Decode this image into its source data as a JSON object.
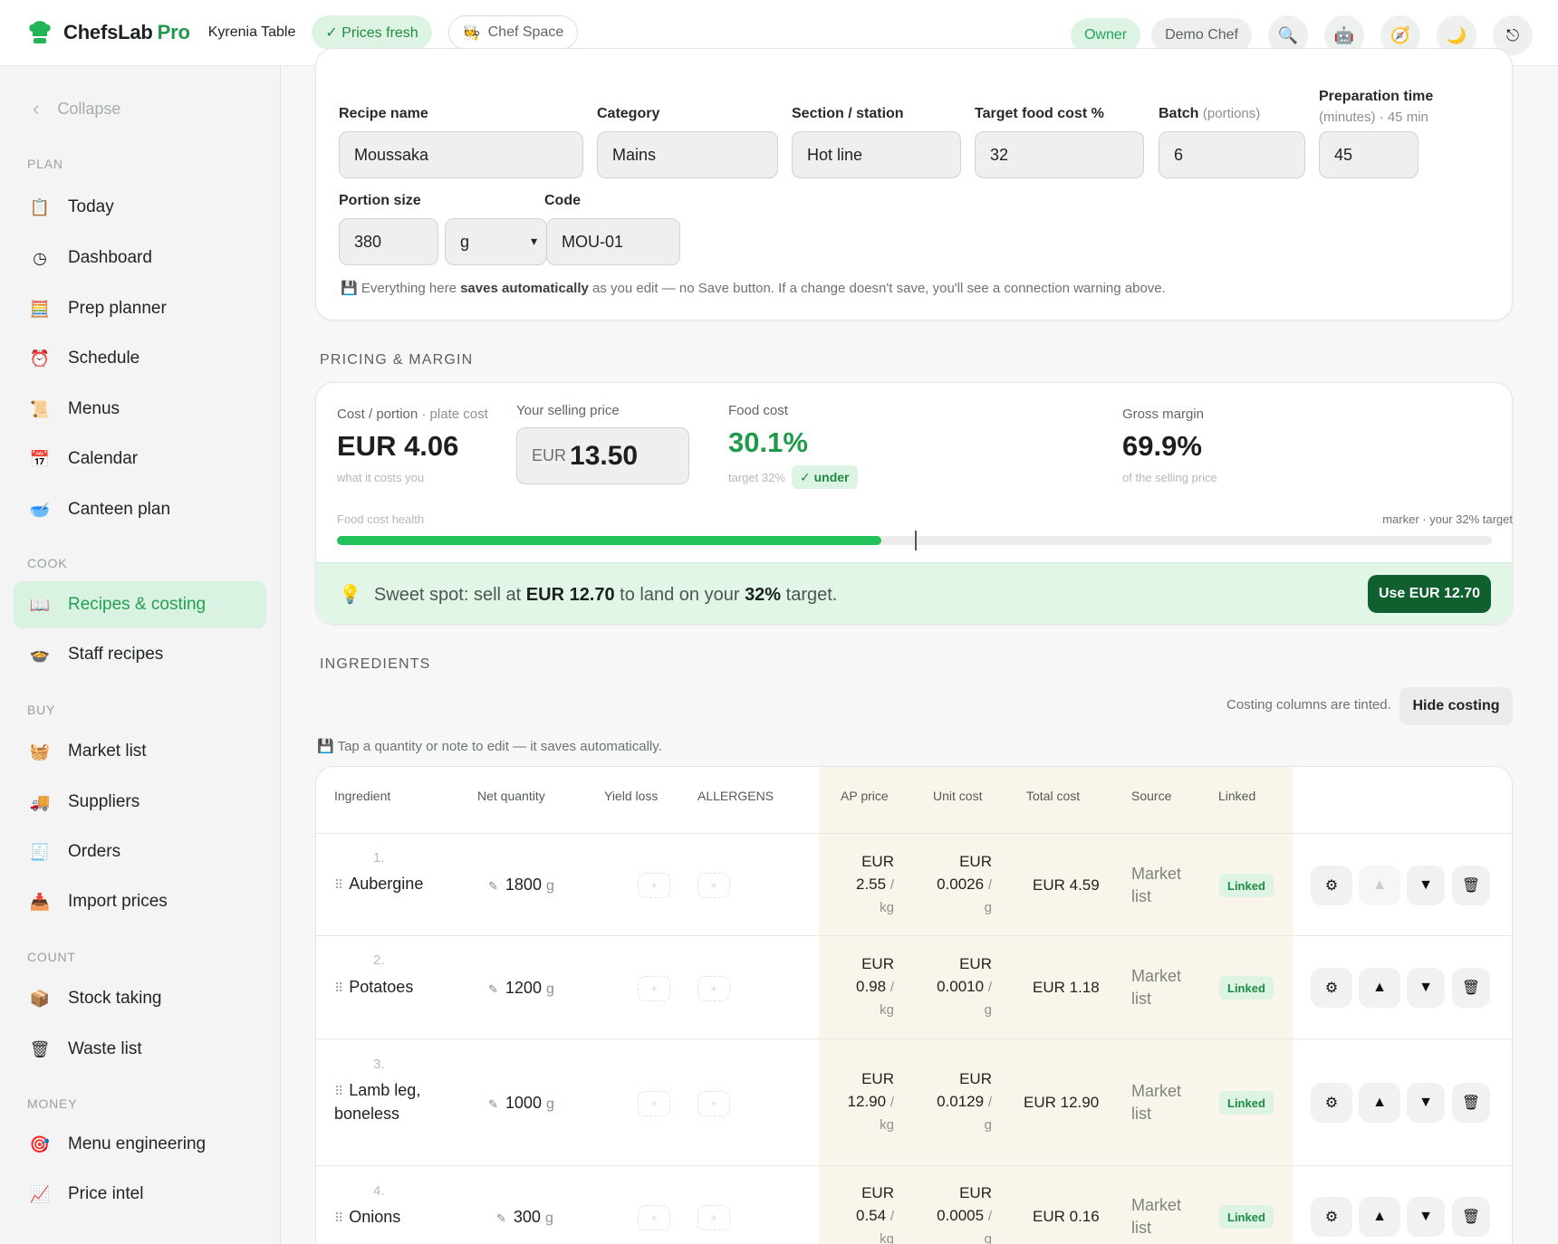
{
  "app": {
    "brand": "ChefsLab",
    "brand_suffix": "Pro",
    "venue": "Kyrenia Table",
    "prices_status": "✓ Prices fresh",
    "chef_space": "Chef Space",
    "role": "Owner",
    "user": "Demo Chef"
  },
  "sidebar": {
    "collapse_label": "Collapse",
    "sections": {
      "plan": "PLAN",
      "cook": "COOK",
      "buy": "BUY",
      "count": "COUNT",
      "money": "MONEY"
    },
    "items": [
      {
        "label": "Today",
        "icon": "clipboard-icon"
      },
      {
        "label": "Dashboard",
        "icon": "clock-icon"
      },
      {
        "label": "Prep planner",
        "icon": "abacus-icon"
      },
      {
        "label": "Schedule",
        "icon": "alarm-clock-icon"
      },
      {
        "label": "Menus",
        "icon": "scroll-icon"
      },
      {
        "label": "Calendar",
        "icon": "calendar-icon"
      },
      {
        "label": "Canteen plan",
        "icon": "bowl-icon"
      },
      {
        "label": "Recipes & costing",
        "icon": "open-book-icon"
      },
      {
        "label": "Staff recipes",
        "icon": "pot-icon"
      },
      {
        "label": "Market list",
        "icon": "basket-icon"
      },
      {
        "label": "Suppliers",
        "icon": "truck-icon"
      },
      {
        "label": "Orders",
        "icon": "receipt-icon"
      },
      {
        "label": "Import prices",
        "icon": "import-icon"
      },
      {
        "label": "Stock taking",
        "icon": "box-icon"
      },
      {
        "label": "Waste list",
        "icon": "trash-basket-icon"
      },
      {
        "label": "Menu engineering",
        "icon": "target-icon"
      },
      {
        "label": "Price intel",
        "icon": "chart-up-icon"
      }
    ]
  },
  "recipe": {
    "labels": {
      "name": "Recipe name",
      "category": "Category",
      "section": "Section / station",
      "target": "Target food cost %",
      "batch": "Batch",
      "batch_sub": "(portions)",
      "prep": "Preparation time",
      "prep_sub": "(minutes) · 45 min",
      "portion": "Portion size",
      "code": "Code"
    },
    "values": {
      "name": "Moussaka",
      "category": "Mains",
      "section": "Hot line",
      "target": "32",
      "batch": "6",
      "prep": "45",
      "portion": "380",
      "unit": "g",
      "code": "MOU-01"
    },
    "autosave_pre": "Everything here ",
    "autosave_bold": "saves automatically",
    "autosave_post": " as you edit — no Save button. If a change doesn't save, you'll see a connection warning above."
  },
  "pricing": {
    "section_title": "PRICING & MARGIN",
    "cost_label": "Cost / portion",
    "cost_sub": " · plate cost",
    "cost_value": "EUR 4.06",
    "cost_note": "what it costs you",
    "sell_label": "Your selling price",
    "sell_currency": "EUR",
    "sell_value": "13.50",
    "food_label": "Food cost",
    "food_value": "30.1%",
    "food_target": "target 32%",
    "food_badge": "✓ under",
    "margin_label": "Gross margin",
    "margin_value": "69.9%",
    "margin_note": "of the selling price",
    "health_label": "Food cost health",
    "marker_label": "marker · your 32% target",
    "health_fill_pct": 47.1,
    "marker_pct": 50.0,
    "sweet_pre": "Sweet spot: sell at ",
    "sweet_price": "EUR 12.70",
    "sweet_mid": " to land on your ",
    "sweet_pct": "32%",
    "sweet_post": " target.",
    "use_button": "Use EUR 12.70"
  },
  "ingredients": {
    "section_title": "INGREDIENTS",
    "tinted_note": "Costing columns are tinted.",
    "hide_button": "Hide costing",
    "edit_note": "Tap a quantity or note to edit — it saves automatically.",
    "columns": {
      "ingredient": "Ingredient",
      "net_qty": "Net quantity",
      "yield": "Yield loss",
      "allergens": "ALLERGENS",
      "ap_price": "AP price",
      "unit_cost": "Unit cost",
      "total_cost": "Total cost",
      "source": "Source",
      "linked": "Linked"
    },
    "rows": [
      {
        "num": "1.",
        "name1": "Aubergine",
        "name2": "",
        "qty": "1800",
        "unit": "g",
        "ap1": "EUR",
        "ap2": "2.55",
        "ap_unit": "kg",
        "uc1": "EUR",
        "uc2": "0.0026",
        "uc_unit": "g",
        "total": "EUR 4.59",
        "src1": "Market",
        "src2": "list",
        "linked": "Linked"
      },
      {
        "num": "2.",
        "name1": "Potatoes",
        "name2": "",
        "qty": "1200",
        "unit": "g",
        "ap1": "EUR",
        "ap2": "0.98",
        "ap_unit": "kg",
        "uc1": "EUR",
        "uc2": "0.0010",
        "uc_unit": "g",
        "total": "EUR 1.18",
        "src1": "Market",
        "src2": "list",
        "linked": "Linked"
      },
      {
        "num": "3.",
        "name1": "Lamb leg,",
        "name2": "boneless",
        "qty": "1000",
        "unit": "g",
        "ap1": "EUR",
        "ap2": "12.90",
        "ap_unit": "kg",
        "uc1": "EUR",
        "uc2": "0.0129",
        "uc_unit": "g",
        "total": "EUR 12.90",
        "src1": "Market",
        "src2": "list",
        "linked": "Linked"
      },
      {
        "num": "4.",
        "name1": "Onions",
        "name2": "",
        "qty": "300",
        "unit": "g",
        "ap1": "EUR",
        "ap2": "0.54",
        "ap_unit": "kg",
        "uc1": "EUR",
        "uc2": "0.0005",
        "uc_unit": "g",
        "total": "EUR 0.16",
        "src1": "Market",
        "src2": "list",
        "linked": "Linked"
      }
    ]
  },
  "colors": {
    "brand_green": "#1f9a4b",
    "fill_green": "#22c15a",
    "button_dark_green": "#0f5f2f",
    "tint": "#f9f5ea"
  }
}
